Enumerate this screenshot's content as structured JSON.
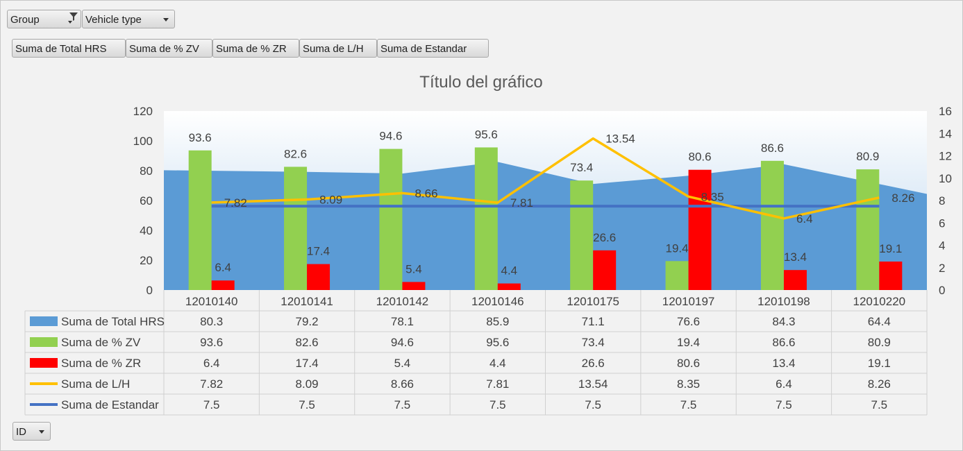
{
  "filters": {
    "group_label": "Group",
    "vehicle_type_label": "Vehicle type",
    "id_label": "ID"
  },
  "value_buttons": [
    "Suma de Total HRS",
    "Suma de % ZV",
    "Suma de % ZR",
    "Suma de L/H",
    "Suma de Estandar"
  ],
  "colors": {
    "total_hrs": "#5b9bd5",
    "zv": "#92d050",
    "zr": "#ff0000",
    "lh": "#ffc000",
    "estandar": "#4472c4"
  },
  "chart_data": {
    "type": "bar",
    "title": "Título del gráfico",
    "categories": [
      "12010140",
      "12010141",
      "12010142",
      "12010146",
      "12010175",
      "12010197",
      "12010198",
      "12010220"
    ],
    "primary_axis": {
      "ylim": [
        0,
        120
      ],
      "ticks": [
        "0",
        "20",
        "40",
        "60",
        "80",
        "100",
        "120"
      ]
    },
    "secondary_axis": {
      "ylim": [
        0,
        16
      ],
      "ticks": [
        "0",
        "2",
        "4",
        "6",
        "8",
        "10",
        "12",
        "14",
        "16"
      ]
    },
    "series": [
      {
        "name": "Suma de Total HRS",
        "kind": "area",
        "axis": "primary",
        "values": [
          80.3,
          79.2,
          78.1,
          85.9,
          71.1,
          76.6,
          84.3,
          64.4
        ],
        "labels": [
          "80.3",
          "79.2",
          "78.1",
          "85.9",
          "71.1",
          "76.6",
          "84.3",
          "64.4"
        ]
      },
      {
        "name": "Suma de % ZV",
        "kind": "bar",
        "axis": "primary",
        "values": [
          93.6,
          82.6,
          94.6,
          95.6,
          73.4,
          19.4,
          86.6,
          80.9
        ],
        "labels": [
          "93.6",
          "82.6",
          "94.6",
          "95.6",
          "73.4",
          "19.4",
          "86.6",
          "80.9"
        ]
      },
      {
        "name": "Suma de % ZR",
        "kind": "bar",
        "axis": "primary",
        "values": [
          6.4,
          17.4,
          5.4,
          4.4,
          26.6,
          80.6,
          13.4,
          19.1
        ],
        "labels": [
          "6.4",
          "17.4",
          "5.4",
          "4.4",
          "26.6",
          "80.6",
          "13.4",
          "19.1"
        ]
      },
      {
        "name": "Suma de L/H",
        "kind": "line",
        "axis": "secondary",
        "values": [
          7.82,
          8.09,
          8.66,
          7.81,
          13.54,
          8.35,
          6.4,
          8.26
        ],
        "labels": [
          "7.82",
          "8.09",
          "8.66",
          "7.81",
          "13.54",
          "8.35",
          "6.4",
          "8.26"
        ]
      },
      {
        "name": "Suma de Estandar",
        "kind": "line",
        "axis": "secondary",
        "values": [
          7.5,
          7.5,
          7.5,
          7.5,
          7.5,
          7.5,
          7.5,
          7.5
        ],
        "labels": [
          "7.5",
          "7.5",
          "7.5",
          "7.5",
          "7.5",
          "7.5",
          "7.5",
          "7.5"
        ]
      }
    ],
    "legend": "data-table"
  }
}
